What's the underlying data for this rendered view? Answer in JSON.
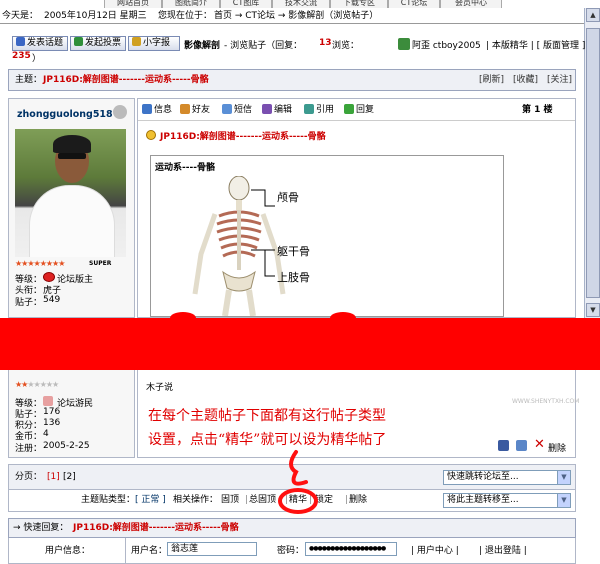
{
  "nav": [
    "网站首页",
    "图纸简介",
    "CT图库",
    "技术交流",
    "下载专区",
    "CT论坛",
    "会员中心"
  ],
  "datebar": {
    "label": "今天是：",
    "date": "2005年10月12日 星期三",
    "loc": "您现在位于：",
    "crumbs": "首页 → CT论坛 → 影像解剖（浏览帖子）"
  },
  "toolbar": {
    "new_topic": "发表话题",
    "new_poll": "发起投票",
    "small_font": "小字报",
    "forum": "影像解剖",
    "viewing": "- 浏览贴子（回复：",
    "replies": "13",
    "views_label": "浏览：",
    "views": "235",
    "views_close": "）",
    "user_label": "阿歪 ctboy2005",
    "links": "| 本版精华 | [ 版面管理 ]"
  },
  "subject": {
    "label": "主题：",
    "title": "JP116D:解剖图谱-------运动系-----骨骼",
    "refresh": "[刷新]",
    "fav": "[收藏]",
    "close": "[关注]"
  },
  "user1": {
    "name": "zhongguolong518",
    "rank_label": "SUPER",
    "grade_label": "等级：",
    "grade": "论坛版主",
    "title_label": "头衔：",
    "title": "虎子",
    "posts_label": "贴子：",
    "posts": "549"
  },
  "post1": {
    "info": "信息",
    "friend": "好友",
    "sms": "短信",
    "edit": "编辑",
    "quote": "引用",
    "reply": "回复",
    "floor": "第 1 楼",
    "title": "JP116D:解剖图谱-------运动系-----骨骼",
    "img_title": "运动系----骨骼",
    "lbl1": "颅骨",
    "lbl2": "躯干骨",
    "lbl3": "上肢骨"
  },
  "user2": {
    "grade_label": "等级：",
    "grade": "论坛游民",
    "posts_label": "贴子：",
    "posts": "176",
    "score_label": "积分：",
    "score": "136",
    "gold_label": "金币：",
    "gold": "4",
    "reg_label": "注册：",
    "reg": "2005-2-25"
  },
  "post2": {
    "quote_text": "木子说",
    "delete": "删除",
    "watermark": "WWW.SHENYTXH.COM"
  },
  "annotation": {
    "line1": "在每个主题帖子下面都有这行帖子类型",
    "line2": "设置，点击“精华”就可以设为精华帖了"
  },
  "pager": {
    "label": "分页：",
    "p1": "[1]",
    "p2": "[2]",
    "jump": "快速跳转论坛至..."
  },
  "types": {
    "label": "主题贴类型：",
    "normal": "[ 正常 ]",
    "ops": "相关操作：",
    "top": "固顶",
    "alltop": "总固顶",
    "digest": "精华",
    "lock": "锁定",
    "del": "删除",
    "move": "将此主题转移至..."
  },
  "quickreply": {
    "label": "→ 快速回复：",
    "title": "JP116D:解剖图谱-------运动系-----骨骼"
  },
  "login": {
    "info_label": "用户信息：",
    "uname_label": "用户名：",
    "uname": "翁志莲",
    "pwd_label": "密码：",
    "pwd": "●●●●●●●●●●●●●●●●●●",
    "center": "| 用户中心 |",
    "logout": "| 退出登陆 |"
  },
  "colors": {
    "accent_red": "#cc0000",
    "band": "#ff0000",
    "ink": "#e00000",
    "bar": "#eef0f5"
  }
}
